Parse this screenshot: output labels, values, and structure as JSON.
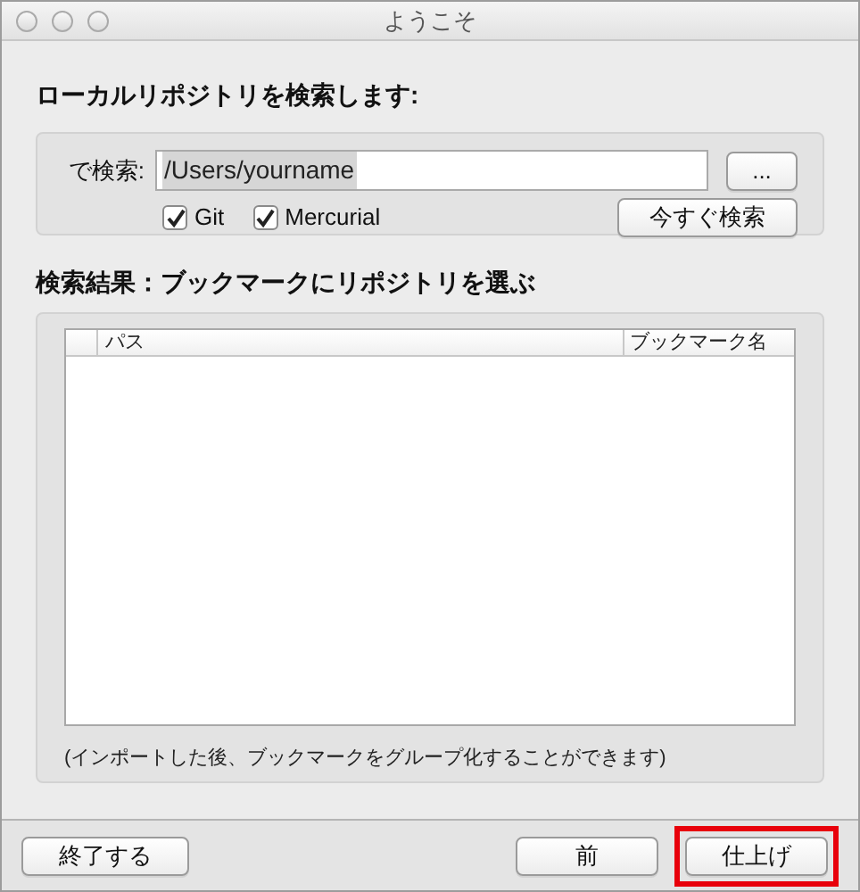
{
  "window": {
    "title": "ようこそ"
  },
  "search_section": {
    "heading": "ローカルリポジトリを検索します:",
    "label": "で検索:",
    "value": "/Users/yourname",
    "browse_button": "...",
    "checkboxes": [
      {
        "label": "Git",
        "checked": true
      },
      {
        "label": "Mercurial",
        "checked": true
      }
    ],
    "search_button": "今すぐ検索"
  },
  "results_section": {
    "heading": "検索結果：ブックマークにリポジトリを選ぶ",
    "columns": [
      "パス",
      "ブックマーク名"
    ],
    "note": "(インポートした後、ブックマークをグループ化することができます)"
  },
  "buttons": [
    {
      "label": "終了する",
      "highlighted": false
    },
    {
      "label": "前",
      "highlighted": false
    },
    {
      "label": "仕上げ",
      "highlighted": true
    }
  ]
}
